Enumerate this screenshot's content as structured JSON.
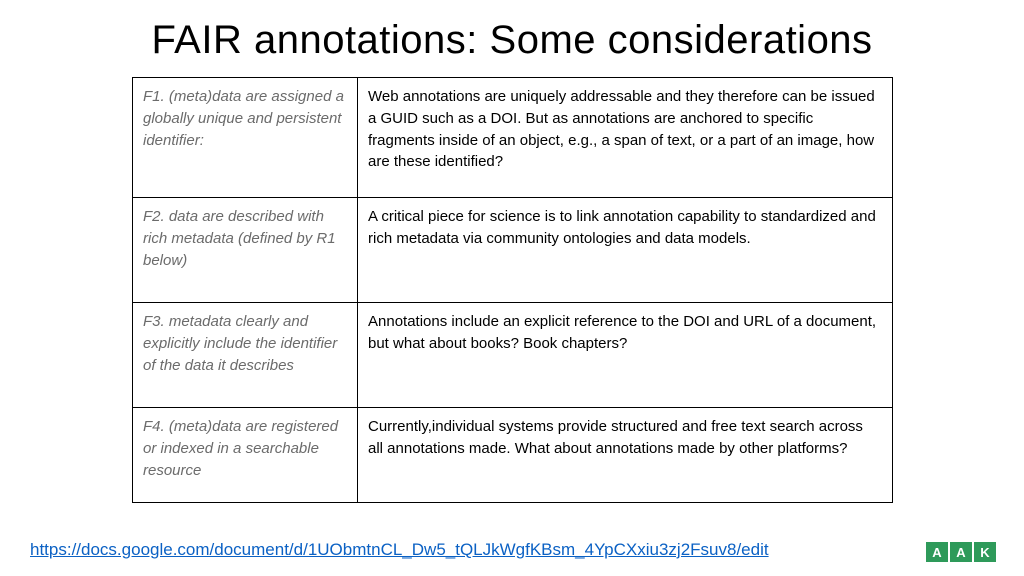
{
  "title": "FAIR annotations:  Some considerations",
  "rows": [
    {
      "principle": "F1. (meta)data are assigned a globally unique and persistent identifier:",
      "consideration": "Web annotations are uniquely addressable and they therefore can be issued a GUID such as a DOI. But as annotations are anchored to specific fragments inside of an object, e.g., a span of text, or a part of an image, how are these identified?"
    },
    {
      "principle": "F2. data are described with rich metadata (defined by R1 below)",
      "consideration": "A critical piece for science is to link annotation capability to standardized and rich metadata via community ontologies and data models."
    },
    {
      "principle": "F3. metadata clearly and explicitly include the identifier of the data it describes",
      "consideration": "Annotations include an explicit reference to the DOI and URL of a document, but what about books? Book chapters?"
    },
    {
      "principle": "F4. (meta)data are registered or indexed in a searchable resource",
      "consideration": "Currently,individual systems provide structured and free text search across all annotations made. What about annotations made by other platforms?"
    }
  ],
  "footer_link": "https://docs.google.com/document/d/1UObmtnCL_Dw5_tQLJkWgfKBsm_4YpCXxiu3zj2Fsuv8/edit",
  "logo": {
    "a": "A",
    "b": "A",
    "c": "K"
  }
}
